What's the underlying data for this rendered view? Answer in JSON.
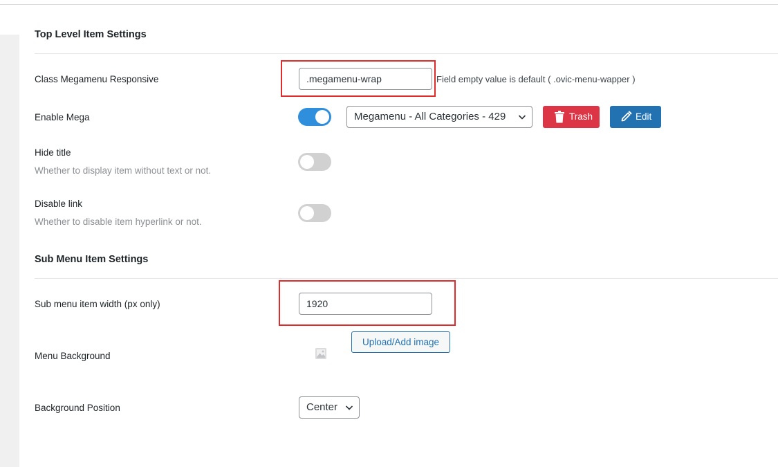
{
  "sections": {
    "top_level_title": "Top Level Item Settings",
    "sub_menu_title": "Sub Menu Item Settings"
  },
  "fields": {
    "class_responsive": {
      "label": "Class Megamenu Responsive",
      "value": ".megamenu-wrap",
      "hint": "Field empty value is default ( .ovic-menu-wapper )"
    },
    "enable_mega": {
      "label": "Enable Mega",
      "enabled": true,
      "selected_menu": "Megamenu - All Categories - 429",
      "trash_label": "Trash",
      "edit_label": "Edit"
    },
    "hide_title": {
      "label": "Hide title",
      "description": "Whether to display item without text or not.",
      "enabled": false
    },
    "disable_link": {
      "label": "Disable link",
      "description": "Whether to disable item hyperlink or not.",
      "enabled": false
    },
    "sub_menu_width": {
      "label": "Sub menu item width (px only)",
      "value": "1920"
    },
    "menu_background": {
      "label": "Menu Background",
      "upload_label": "Upload/Add image",
      "icon": "image-placeholder-icon"
    },
    "background_position": {
      "label": "Background Position",
      "selected": "Center"
    }
  },
  "colors": {
    "toggle_on": "#2f8fdc",
    "toggle_off": "#d1d1d1",
    "trash_button": "#dc3545",
    "edit_button": "#2271b1",
    "highlight_box": "#e02b2b"
  }
}
